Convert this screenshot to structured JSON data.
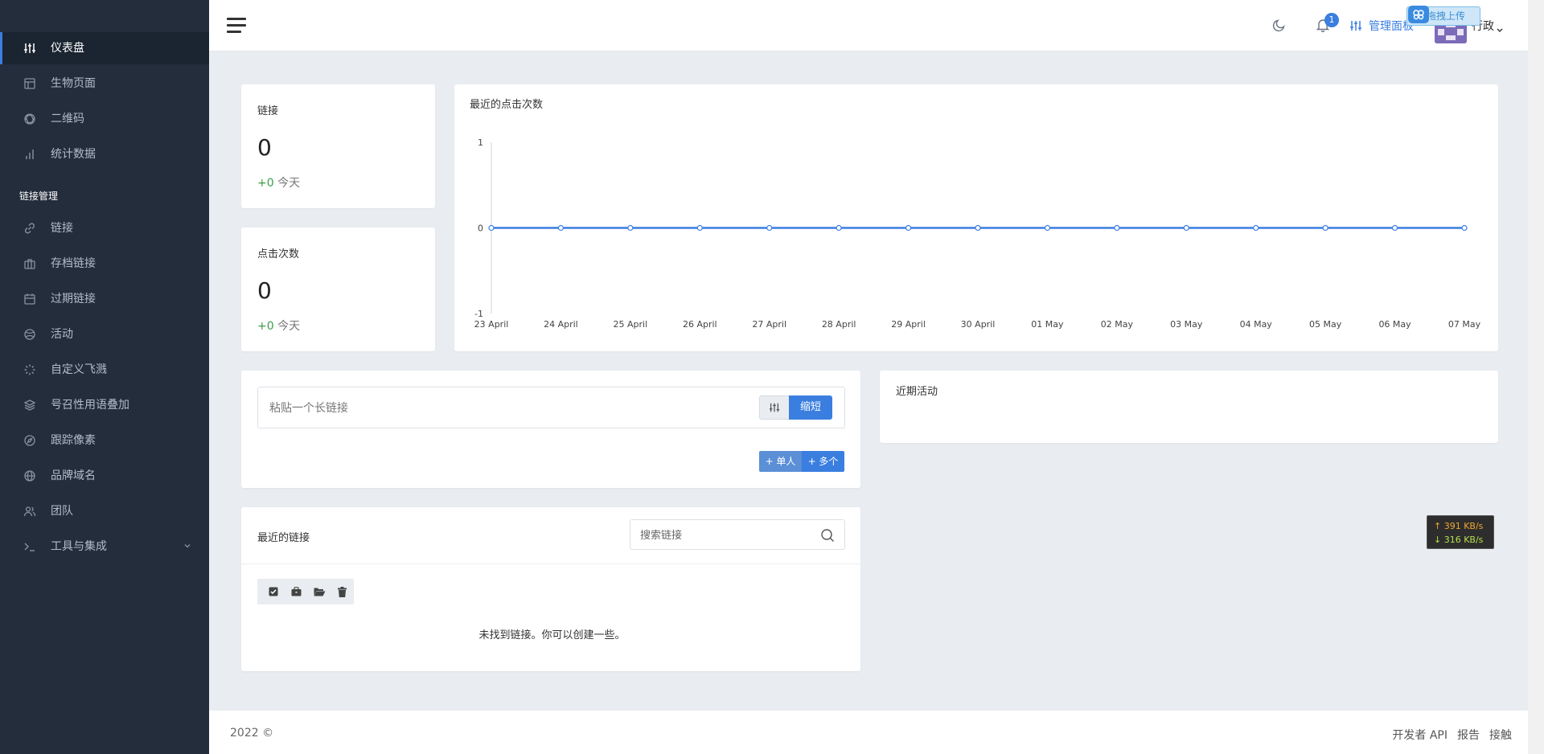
{
  "sidebar": {
    "items": [
      {
        "label": "仪表盘",
        "icon": "sliders-icon"
      },
      {
        "label": "生物页面",
        "icon": "layout-icon"
      },
      {
        "label": "二维码",
        "icon": "aperture-icon"
      },
      {
        "label": "统计数据",
        "icon": "bar-chart-icon"
      },
      {
        "label": "链接",
        "icon": "link-icon"
      },
      {
        "label": "存档链接",
        "icon": "briefcase-icon"
      },
      {
        "label": "过期链接",
        "icon": "calendar-icon"
      },
      {
        "label": "活动",
        "icon": "globe-icon"
      },
      {
        "label": "自定义飞溅",
        "icon": "loader-icon"
      },
      {
        "label": "号召性用语叠加",
        "icon": "layers-icon"
      },
      {
        "label": "跟踪像素",
        "icon": "compass-icon"
      },
      {
        "label": "品牌域名",
        "icon": "globe-icon"
      },
      {
        "label": "团队",
        "icon": "users-icon"
      },
      {
        "label": "工具与集成",
        "icon": "terminal-icon"
      }
    ],
    "section_label": "链接管理"
  },
  "header": {
    "notification_count": "1",
    "admin_label": "管理面板",
    "user_name": "行政",
    "upload_label": "拖拽上传"
  },
  "stats": {
    "links": {
      "title": "链接",
      "value": "0",
      "delta": "+0",
      "delta_label": "今天"
    },
    "clicks": {
      "title": "点击次数",
      "value": "0",
      "delta": "+0",
      "delta_label": "今天"
    }
  },
  "chart_data": {
    "type": "line",
    "title": "最近的点击次数",
    "x": [
      "23 April",
      "24 April",
      "25 April",
      "26 April",
      "27 April",
      "28 April",
      "29 April",
      "30 April",
      "01 May",
      "02 May",
      "03 May",
      "04 May",
      "05 May",
      "06 May",
      "07 May"
    ],
    "series": [
      {
        "values": [
          0,
          0,
          0,
          0,
          0,
          0,
          0,
          0,
          0,
          0,
          0,
          0,
          0,
          0,
          0
        ]
      }
    ],
    "ylim": [
      -1,
      1
    ],
    "yticks": [
      "1",
      "0",
      "-1"
    ],
    "color": "#3a7ee0"
  },
  "shortener": {
    "placeholder": "粘贴一个长链接",
    "shorten_label": "缩短",
    "single_label": "+ 单人",
    "multi_label": "+ 多个"
  },
  "activity": {
    "title": "近期活动"
  },
  "recent_links": {
    "title": "最近的链接",
    "search_placeholder": "搜索链接",
    "empty_message": "未找到链接。你可以创建一些。"
  },
  "speed": {
    "up": "↑ 391 KB/s",
    "down": "↓ 316 KB/s"
  },
  "footer": {
    "copyright": "2022 ©",
    "links": [
      "开发者 API",
      "报告",
      "接触"
    ]
  }
}
